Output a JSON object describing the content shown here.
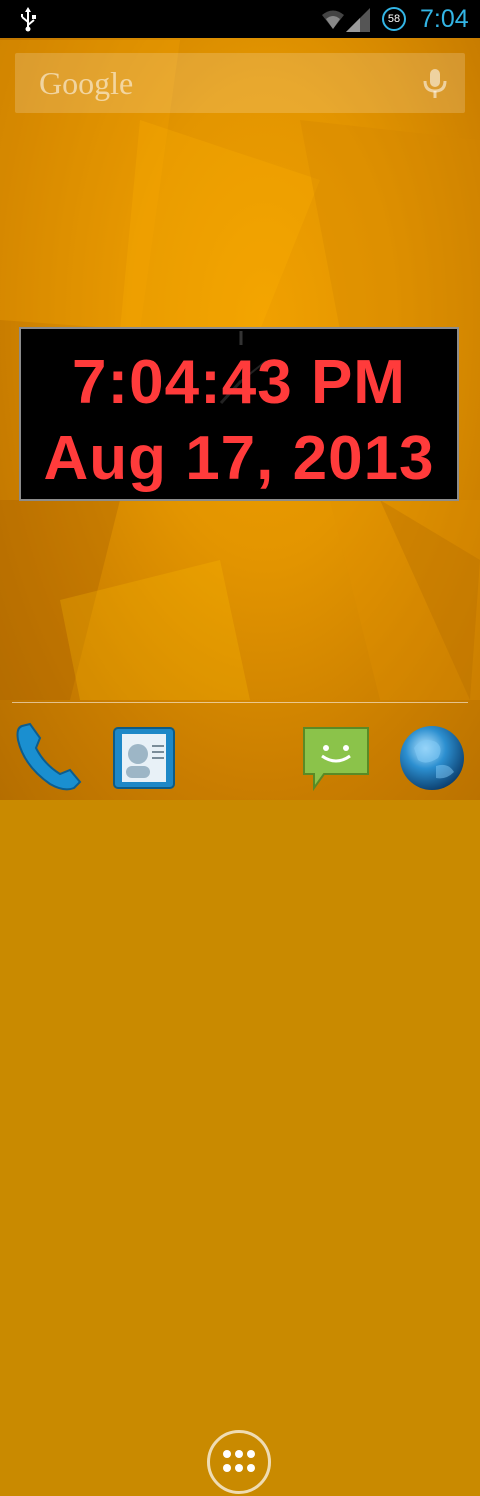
{
  "status_bar": {
    "time": "7:04",
    "battery_level": "58",
    "icons": [
      "usb-icon",
      "wifi-icon",
      "cell-signal-icon",
      "battery-icon"
    ],
    "accent_color": "#33b5e5"
  },
  "search_bar": {
    "logo_text": "Google",
    "icons": [
      "mic-icon"
    ]
  },
  "clock_widget": {
    "time": "7:04:43 PM",
    "date": "Aug 17, 2013",
    "text_color": "#ff3b3b"
  },
  "dock": {
    "items": [
      {
        "icon": "phone-icon"
      },
      {
        "icon": "contacts-icon"
      },
      {
        "icon": "all-apps-icon"
      },
      {
        "icon": "messaging-icon"
      },
      {
        "icon": "browser-icon"
      }
    ]
  }
}
